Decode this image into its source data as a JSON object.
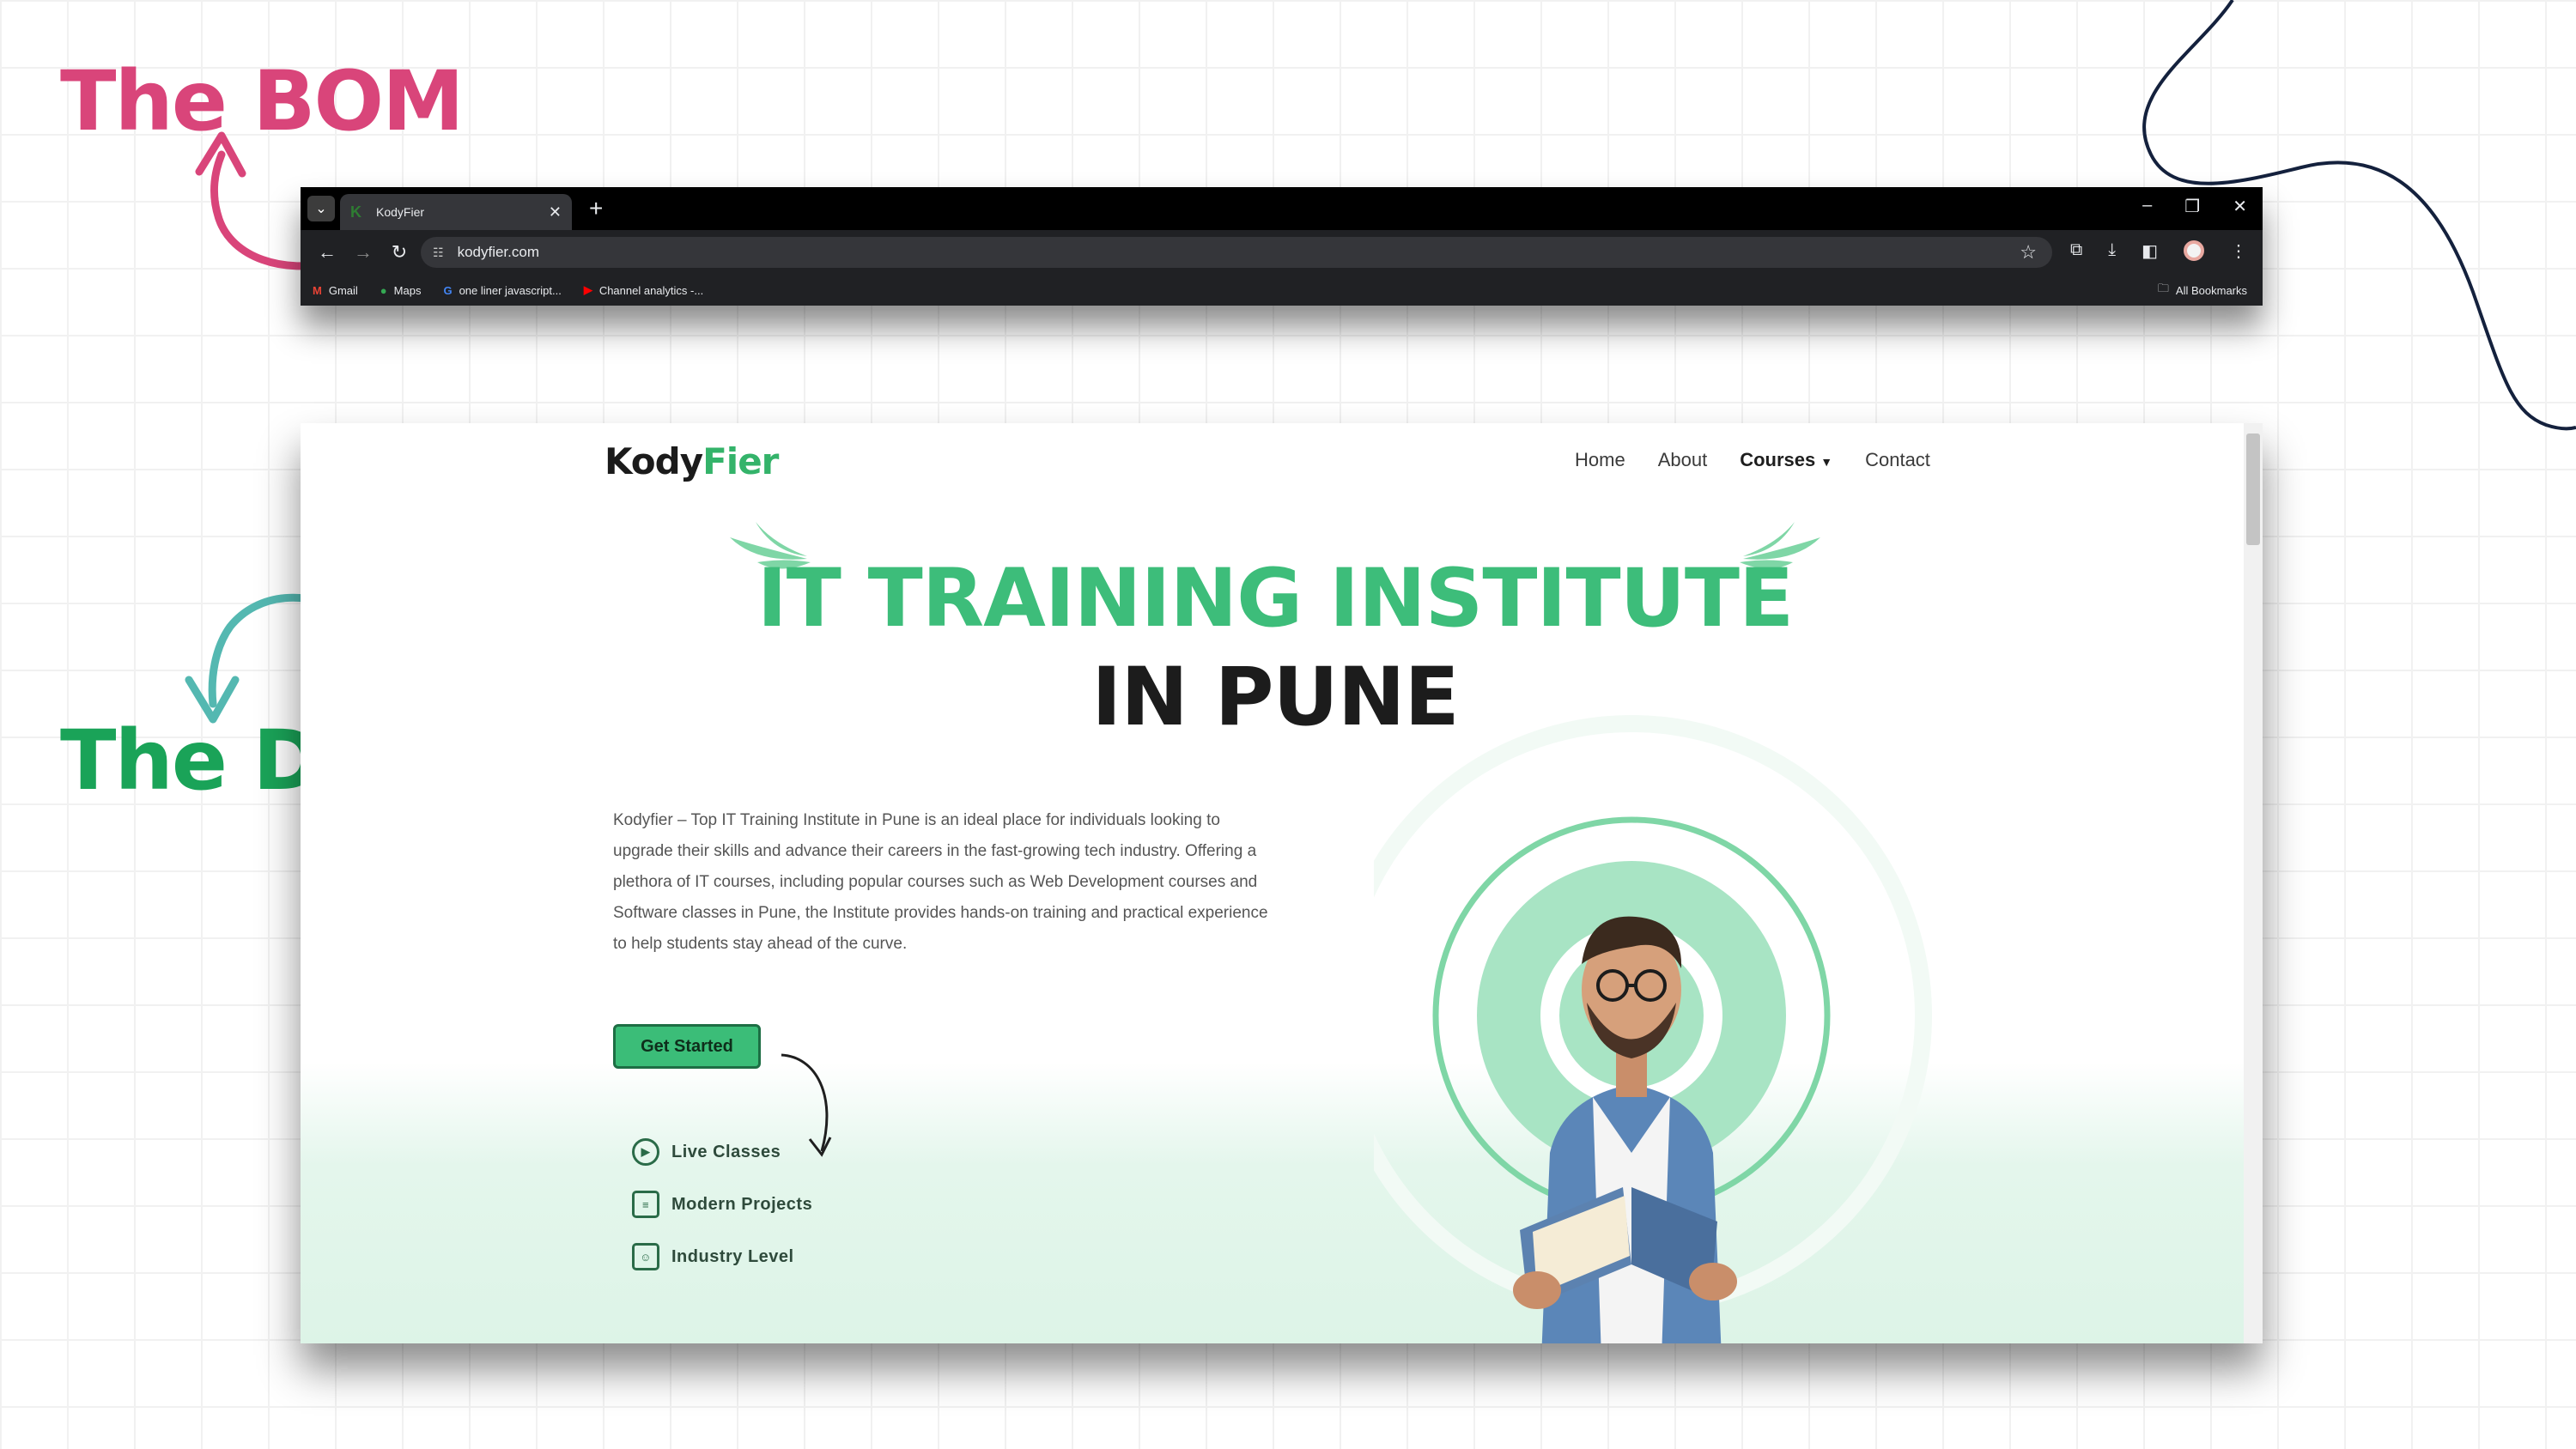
{
  "slide": {
    "bom_label": "The BOM",
    "dom_label": "The DOM",
    "colors": {
      "bom": "#d9457a",
      "dom": "#1aa358",
      "dom_arrow": "#54b8b1"
    }
  },
  "browser": {
    "tab_title": "KodyFier",
    "url": "kodyfier.com",
    "bookmarks": [
      {
        "label": "Gmail",
        "icon": "gmail-icon"
      },
      {
        "label": "Maps",
        "icon": "maps-pin-icon"
      },
      {
        "label": "one liner javascript...",
        "icon": "google-icon"
      },
      {
        "label": "Channel analytics -...",
        "icon": "youtube-icon"
      }
    ],
    "all_bookmarks": "All Bookmarks"
  },
  "site": {
    "logo_left": "Kody",
    "logo_right": "Fier",
    "nav": [
      "Home",
      "About",
      "Courses",
      "Contact"
    ],
    "headline_1": "IT TRAINING INSTITUTE",
    "headline_2": "IN PUNE",
    "intro": "Kodyfier – Top IT Training Institute in Pune is an ideal place for individuals looking to upgrade their skills and advance their careers in the fast-growing tech industry. Offering a plethora of IT courses, including popular courses such as Web Development courses and Software classes in Pune, the Institute provides hands-on training and practical experience to help students stay ahead of the curve.",
    "cta": "Get Started",
    "features": [
      {
        "label": "Live Classes",
        "icon": "play-circle-icon"
      },
      {
        "label": "Modern Projects",
        "icon": "clipboard-icon"
      },
      {
        "label": "Industry Level",
        "icon": "user-badge-icon"
      }
    ],
    "colors": {
      "accent": "#3dbd7a",
      "dark": "#1c1c1c"
    }
  }
}
